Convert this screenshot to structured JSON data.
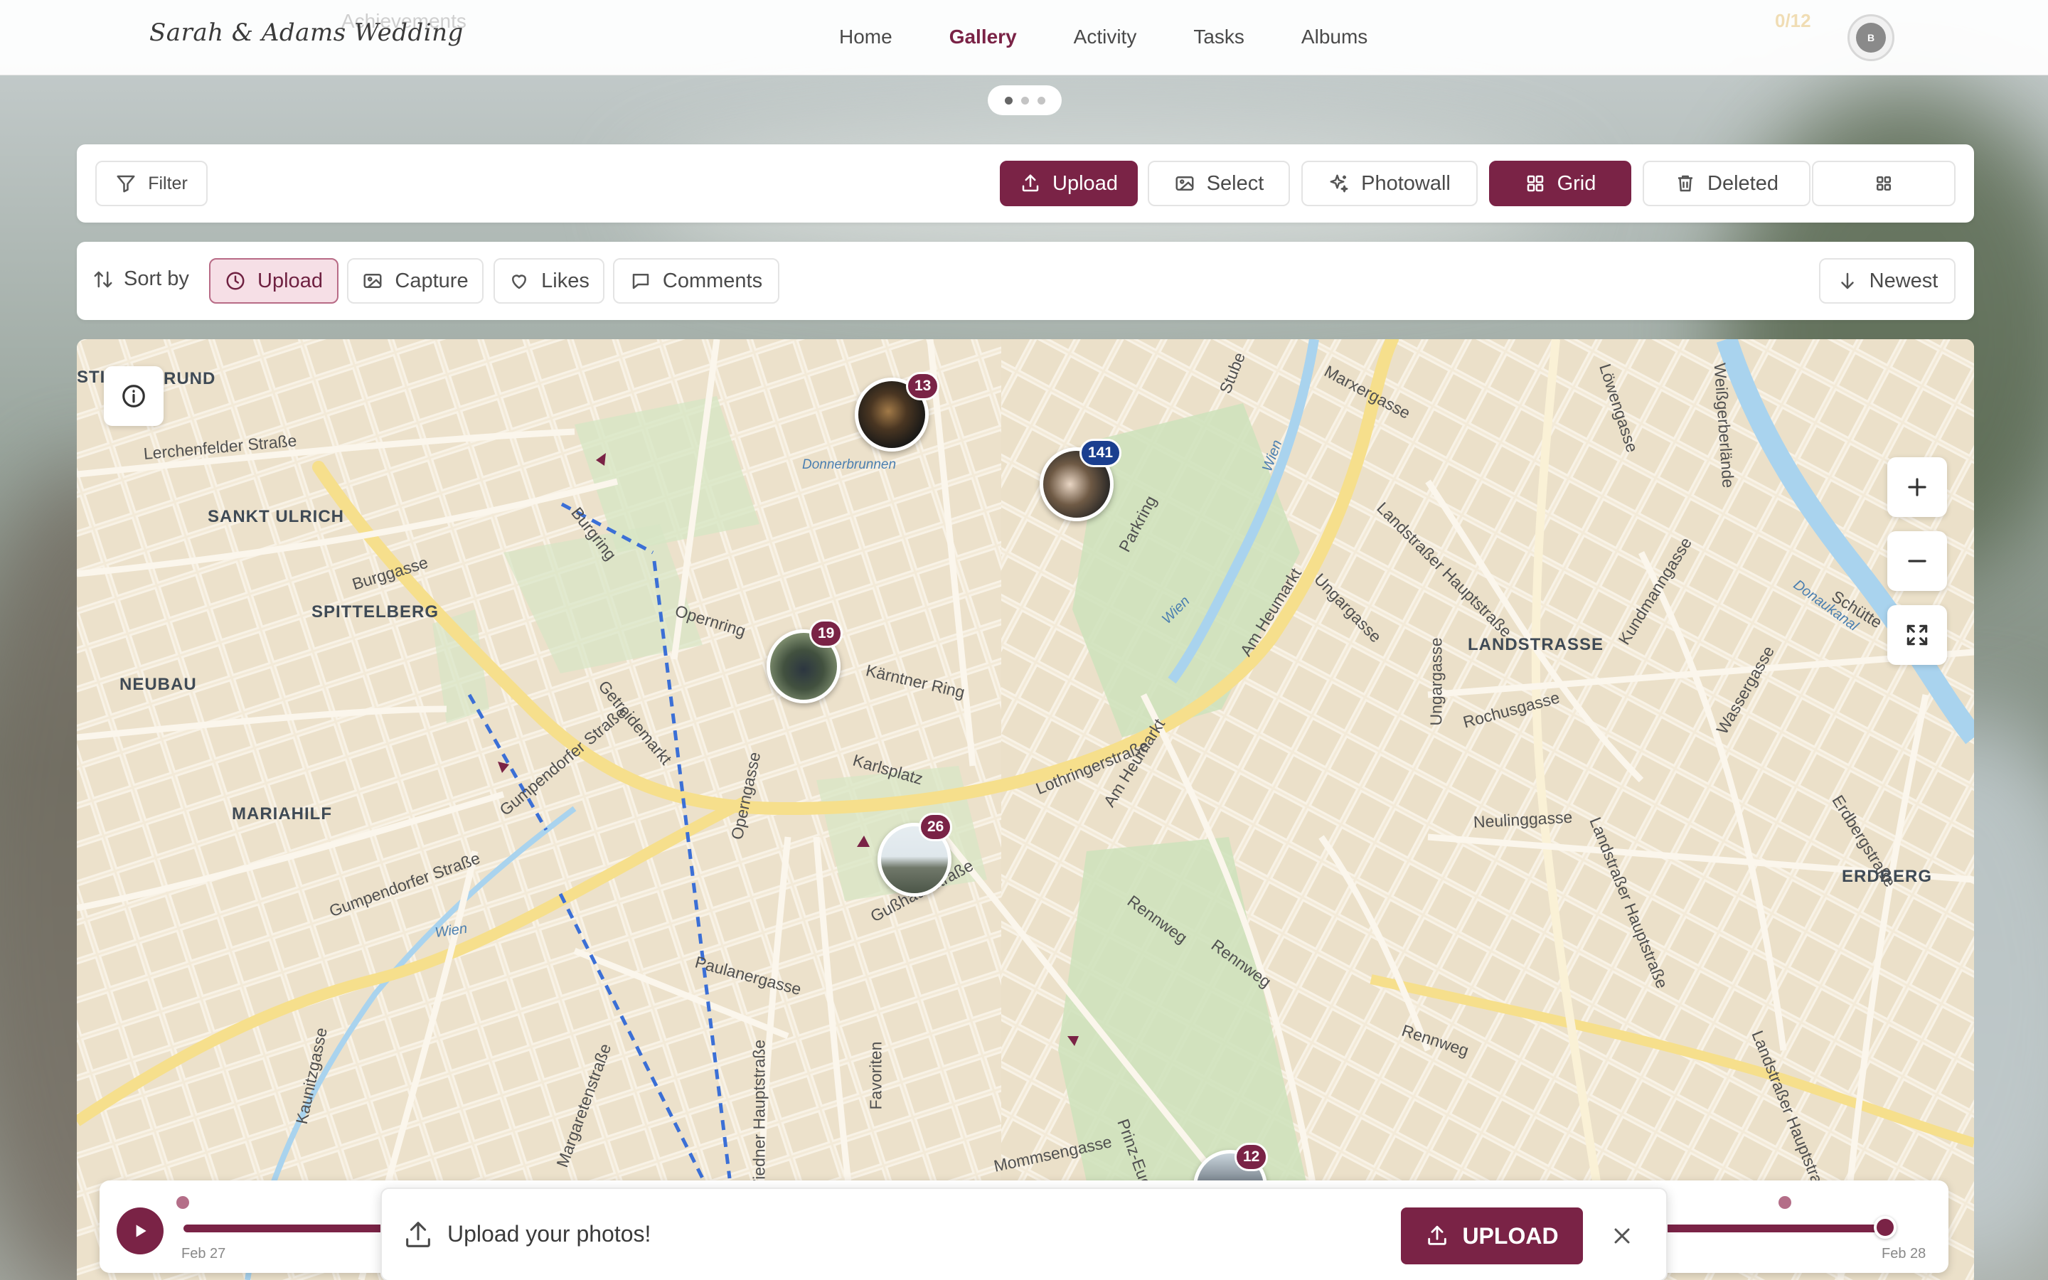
{
  "brand": {
    "name": "Sarah & Adams Wedding"
  },
  "ghost": {
    "achievements": "Achievements",
    "count": "0/12"
  },
  "nav": {
    "items": [
      {
        "label": "Home",
        "active": false
      },
      {
        "label": "Gallery",
        "active": true
      },
      {
        "label": "Activity",
        "active": false
      },
      {
        "label": "Tasks",
        "active": false
      },
      {
        "label": "Albums",
        "active": false
      }
    ],
    "avatar_initial": "B"
  },
  "pager": {
    "count": 3,
    "active_index": 0
  },
  "toolbar": {
    "filter": "Filter",
    "upload": "Upload",
    "select": "Select",
    "photowall": "Photowall",
    "grid": "Grid",
    "deleted": "Deleted"
  },
  "sort": {
    "label": "Sort by",
    "options": [
      "Upload",
      "Capture",
      "Likes",
      "Comments"
    ],
    "active": "Upload",
    "order": "Newest"
  },
  "map": {
    "districts": [
      "RUND",
      "SANKT ULRICH",
      "SPITTELBERG",
      "NEUBAU",
      "MARIAHILF",
      "LANDSTRASSE",
      "ERDBERG"
    ],
    "streets": [
      "Lerchenfelder Straße",
      "Burgring",
      "Burggasse",
      "Opernring",
      "Kärntner Ring",
      "Getreidemarkt",
      "Gumpendorfer Straße",
      "Operngasse",
      "Karlsplatz",
      "Lothringerstraße",
      "Am Heumarkt",
      "Parkring",
      "Stubenring",
      "Marxergasse",
      "Landstraßer Hauptstraße",
      "Ungargasse",
      "Rochusgasse",
      "Neulinggasse",
      "Rennweg",
      "Paulanergasse",
      "Wiedner Hauptstraße",
      "Margaretenstraße",
      "Kaunitzgasse",
      "Gußhausstraße",
      "Prinz-Eugen",
      "Wassergasse",
      "Kundmanngasse",
      "Erdbergstraße",
      "Löwengasse",
      "Weißgerberlände",
      "Schütte",
      "Favoriten",
      "Mommsengasse",
      "Donnerbrunnen"
    ],
    "water_labels": [
      "Wien",
      "Donaukanal"
    ],
    "markers": [
      {
        "count": "13"
      },
      {
        "count": "141"
      },
      {
        "count": "19"
      },
      {
        "count": "26"
      },
      {
        "count": "12"
      }
    ]
  },
  "timeline": {
    "start": "Feb 27",
    "end": "Feb 28"
  },
  "toast": {
    "message": "Upload your photos!",
    "button": "UPLOAD"
  }
}
